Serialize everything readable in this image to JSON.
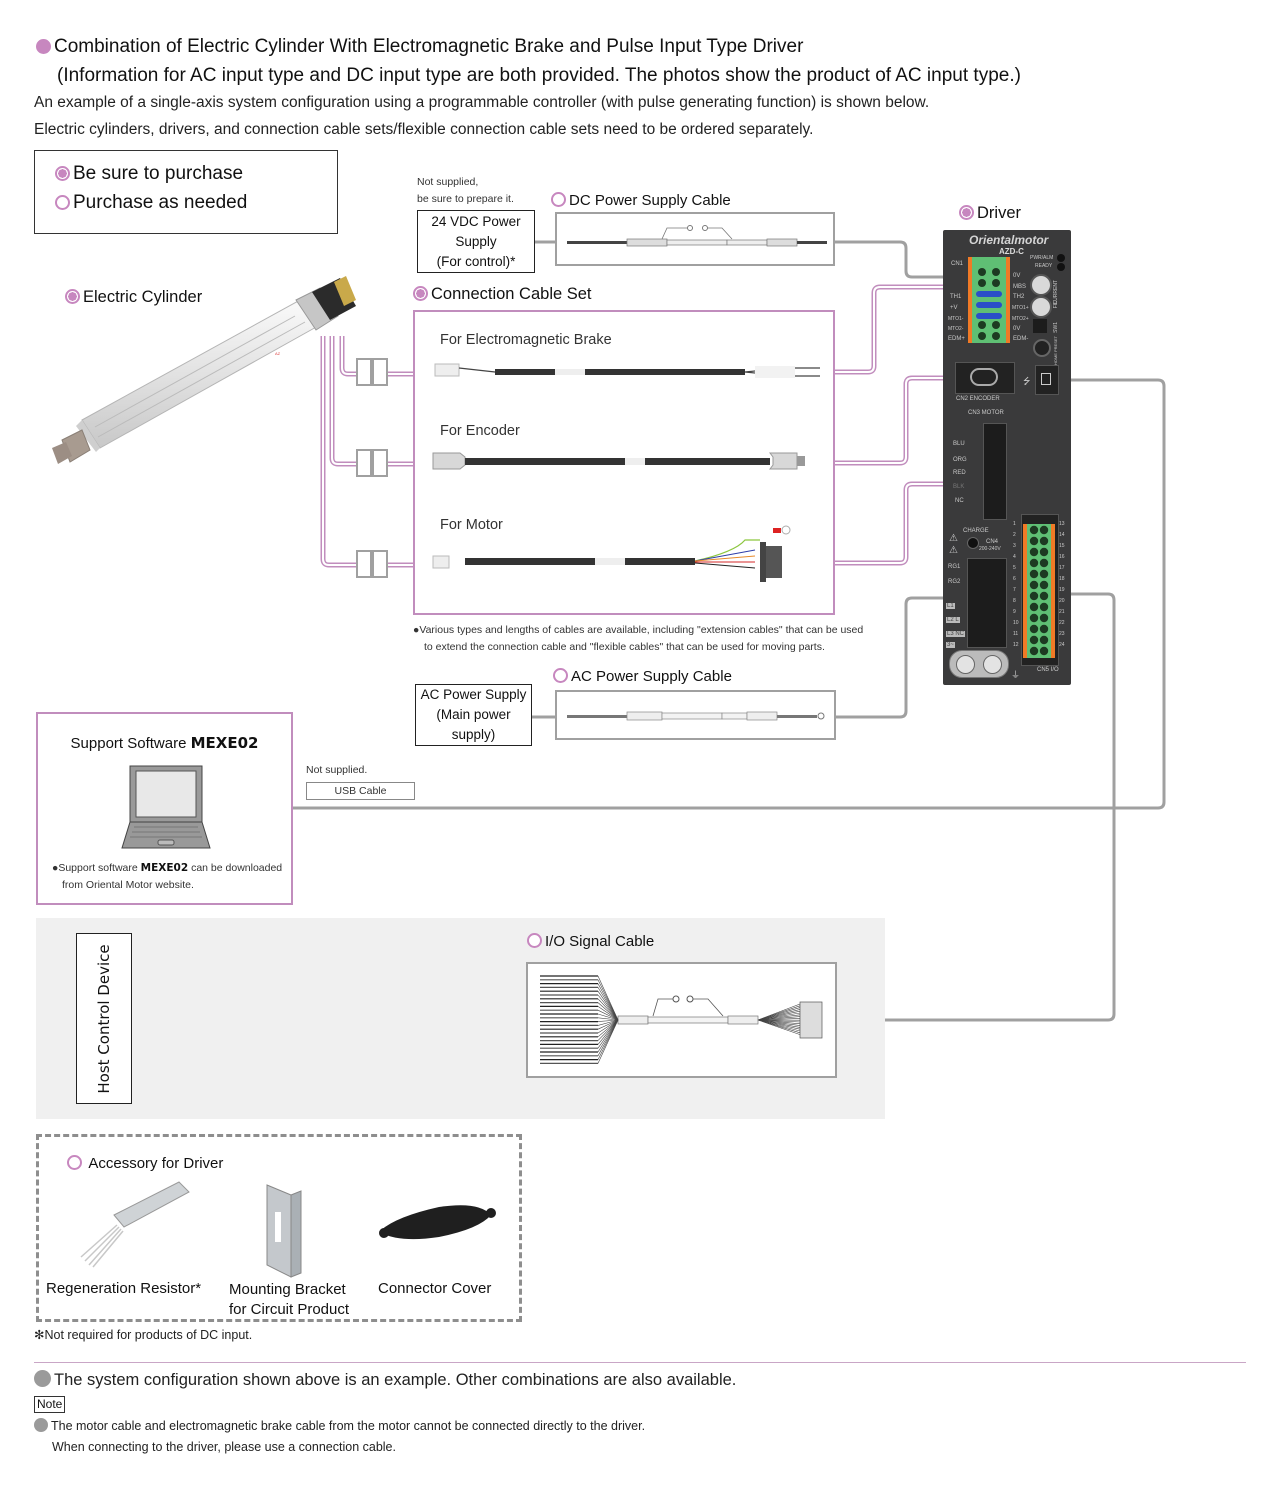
{
  "header": {
    "title_line1": "Combination of Electric Cylinder With Electromagnetic Brake and Pulse Input Type Driver",
    "title_line2": "(Information for AC input type and DC input type are both provided.  The photos show the product of AC input type.)",
    "intro_line1": "An example of a single-axis system configuration using a programmable controller (with pulse generating function) is shown below.",
    "intro_line2": "Electric cylinders, drivers, and connection cable sets/flexible connection cable sets need to be ordered separately."
  },
  "legend": {
    "must_purchase": "Be sure to purchase",
    "optional": "Purchase as needed"
  },
  "colors": {
    "accent": "#c787bf",
    "pink_line": "#c18dbd",
    "gray_line": "#a0a0a0",
    "panel_bg": "#f0f0f0",
    "driver_body": "#3a3a3b",
    "terminal_green": "#5fbf74",
    "terminal_orange": "#f07a26"
  },
  "electric_cylinder": {
    "label": "Electric Cylinder",
    "icon": "electric-cylinder-photo"
  },
  "dc_power": {
    "not_supplied_line1": "Not supplied,",
    "not_supplied_line2": "be sure to prepare it.",
    "supply_line1": "24 VDC Power Supply",
    "supply_line2": "(For control)*",
    "cable_label": "DC Power Supply Cable"
  },
  "connection_cable_set": {
    "label": "Connection Cable Set",
    "cables": [
      {
        "label": "For Electromagnetic Brake"
      },
      {
        "label": "For Encoder"
      },
      {
        "label": "For Motor"
      }
    ],
    "note_line1": "Various types and lengths of cables are available, including \"extension cables\" that can be used",
    "note_line2": "to extend the connection cable and \"flexible cables\" that can be used for moving parts."
  },
  "ac_power": {
    "supply_line1": "AC Power Supply",
    "supply_line2": "(Main power supply)",
    "cable_label": "AC Power Supply Cable"
  },
  "driver": {
    "label": "Driver",
    "brand": "Orientalmotor",
    "model": "AZD-C",
    "cn1": "CN1",
    "cn1_left_pins": [
      "TH1",
      "+V",
      "MTO1-",
      "MTO2-",
      "EDM+"
    ],
    "cn1_right_pins": [
      "0V",
      "MBS",
      "TH2",
      "MTO1+",
      "MTO2+",
      "0V",
      "EDM-"
    ],
    "leds": [
      "PWR/ALM",
      "READY"
    ],
    "switches": [
      "CURRENT",
      "FIL",
      "SW1"
    ],
    "home_preset": "HOME PRESET",
    "cn2": "CN2 ENCODER",
    "cn3": "CN3 MOTOR",
    "cn3_pins": [
      "BLU",
      "ORG",
      "RED",
      "BLK",
      "NC"
    ],
    "charge": "CHARGE",
    "cn4": "CN4",
    "cn4_voltage": "200-240V",
    "cn4_pins": [
      "RG1",
      "RG2",
      "L1",
      "L2 L",
      "L3 NC",
      "3~"
    ],
    "cn5": "CN5 I/O",
    "cn5_left_numbers": [
      "1",
      "2",
      "3",
      "4",
      "5",
      "6",
      "7",
      "8",
      "9",
      "10",
      "11",
      "12"
    ],
    "cn5_right_numbers": [
      "13",
      "14",
      "15",
      "16",
      "17",
      "18",
      "19",
      "20",
      "21",
      "22",
      "23",
      "24"
    ]
  },
  "software": {
    "title_prefix": "Support Software ",
    "title_name": "MEXE02",
    "note_prefix": "Support software ",
    "note_name": "MEXE02",
    "note_suffix": " can be downloaded",
    "note_line2": "from Oriental Motor website."
  },
  "usb": {
    "not_supplied": "Not supplied.",
    "cable_label": "USB Cable"
  },
  "host": {
    "label": "Host Control Device"
  },
  "io_cable": {
    "label": "I/O Signal Cable"
  },
  "accessories": {
    "title": "Accessory for Driver",
    "items": [
      {
        "label": "Regeneration Resistor*"
      },
      {
        "label_line1": "Mounting Bracket",
        "label_line2": "for Circuit Product"
      },
      {
        "label": "Connector Cover"
      }
    ],
    "footnote": "Not required for products of DC input.",
    "footnote_mark": "✻"
  },
  "footer": {
    "example_note": "The system configuration shown above is an example. Other combinations are also available.",
    "note_tag": "Note",
    "note_line1": "The motor cable and electromagnetic brake cable from the motor cannot be connected directly to the driver.",
    "note_line2": "When connecting to the driver, please use a connection cable."
  }
}
